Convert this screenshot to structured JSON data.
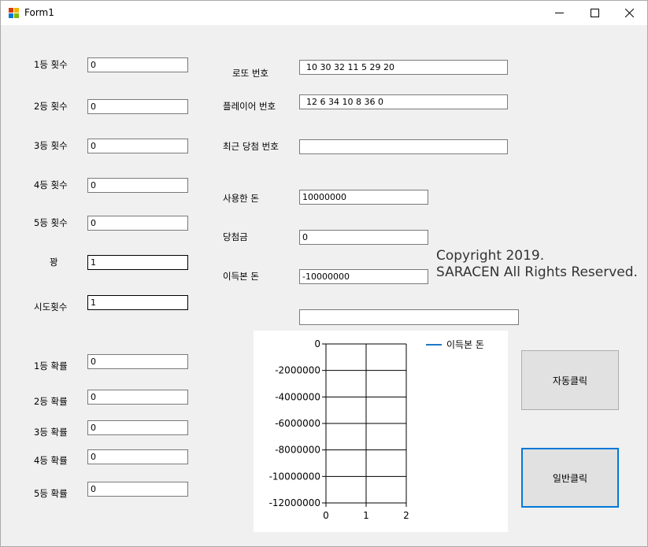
{
  "window": {
    "title": "Form1"
  },
  "counts": [
    {
      "label": "1등 횟수",
      "value": "0"
    },
    {
      "label": "2등 횟수",
      "value": "0"
    },
    {
      "label": "3등 횟수",
      "value": "0"
    },
    {
      "label": "4등 횟수",
      "value": "0"
    },
    {
      "label": "5등 횟수",
      "value": "0"
    },
    {
      "label": "꽝",
      "value": "1"
    },
    {
      "label": "시도횟수",
      "value": "1"
    }
  ],
  "probabilities": [
    {
      "label": "1등 확률",
      "value": "0"
    },
    {
      "label": "2등 확률",
      "value": "0"
    },
    {
      "label": "3등 확률",
      "value": "0"
    },
    {
      "label": "4등 확률",
      "value": "0"
    },
    {
      "label": "5등 확률",
      "value": "0"
    }
  ],
  "lotto": {
    "lotto_label": "로또 번호",
    "lotto_value": "10 30 32 11 5 29 20",
    "player_label": "플레이어 번호",
    "player_value": "12 6 34 10 8 36 0",
    "recent_label": "최근 당첨 번호",
    "recent_value": ""
  },
  "money": {
    "spent_label": "사용한 돈",
    "spent_value": "10000000",
    "prize_label": "당첨금",
    "prize_value": "0",
    "profit_label": "이득본 돈",
    "profit_value": "-10000000"
  },
  "extra_field": {
    "value": ""
  },
  "copyright": {
    "line1": "Copyright 2019.",
    "line2": "SARACEN All Rights Reserved."
  },
  "buttons": {
    "auto_label": "자동클릭",
    "normal_label": "일반클릭"
  },
  "chart_data": {
    "type": "line",
    "x": [],
    "series": [
      {
        "name": "이득본 돈",
        "values": [],
        "color": "#1e78c8"
      }
    ],
    "xlim": [
      0,
      2
    ],
    "ylim": [
      -12000000,
      0
    ],
    "x_ticks": [
      "0",
      "1",
      "2"
    ],
    "y_ticks": [
      "0",
      "-2000000",
      "-4000000",
      "-6000000",
      "-8000000",
      "-10000000",
      "-12000000"
    ],
    "grid": true,
    "legend": "top-right"
  }
}
